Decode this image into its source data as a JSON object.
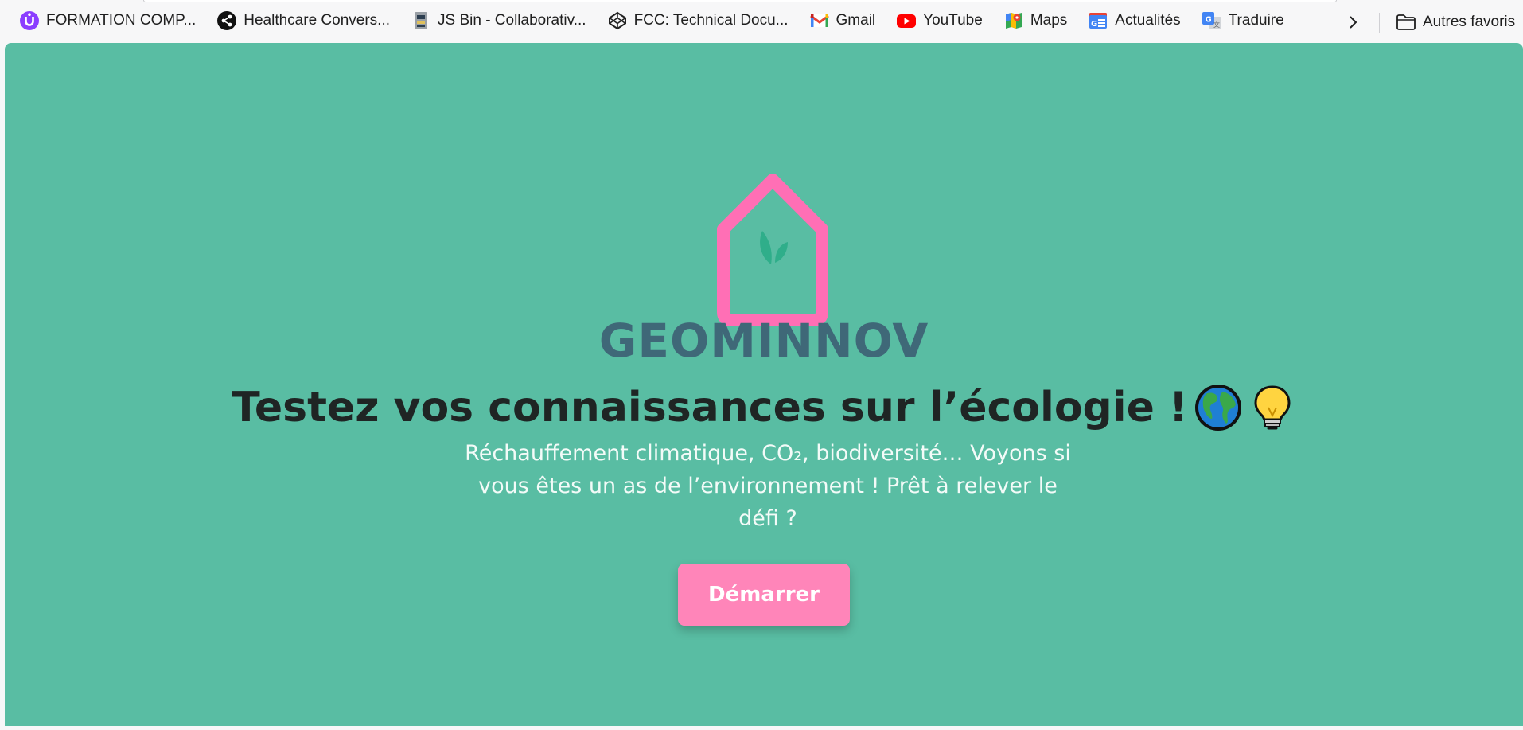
{
  "bookmarks_bar": {
    "items": [
      {
        "label": "FORMATION COMP...",
        "icon": "u-badge-icon",
        "color": "#8b3dff"
      },
      {
        "label": "Healthcare Convers...",
        "icon": "share-icon",
        "color": "#111111"
      },
      {
        "label": "JS Bin - Collaborativ...",
        "icon": "jsbin-icon",
        "color": "#8a8a8a"
      },
      {
        "label": "FCC: Technical Docu...",
        "icon": "codepen-icon",
        "color": "#222222"
      },
      {
        "label": "Gmail",
        "icon": "gmail-icon",
        "color": "#ea4335"
      },
      {
        "label": "YouTube",
        "icon": "youtube-icon",
        "color": "#ff0000"
      },
      {
        "label": "Maps",
        "icon": "maps-icon",
        "color": "#34a853"
      },
      {
        "label": "Actualités",
        "icon": "news-icon",
        "color": "#4285f4"
      },
      {
        "label": "Traduire",
        "icon": "translate-icon",
        "color": "#4285f4"
      }
    ],
    "other_favorites": "Autres favoris"
  },
  "page": {
    "background": "#59bda3",
    "brand": "GEOMINNOV",
    "brand_color": "#3f6878",
    "logo_colors": {
      "house": "#ff6fb5",
      "leaf": "#2fae8a"
    },
    "headline": "Testez vos connaissances sur l’écologie !",
    "headline_emojis": [
      "globe-icon",
      "light-bulb-icon"
    ],
    "subtitle": "Réchauffement climatique, CO₂, biodiversité… Voyons si vous êtes un as de l’environnement ! Prêt à relever le défi ?",
    "start_button": "Démarrer",
    "button_color": "#ff85b9"
  }
}
